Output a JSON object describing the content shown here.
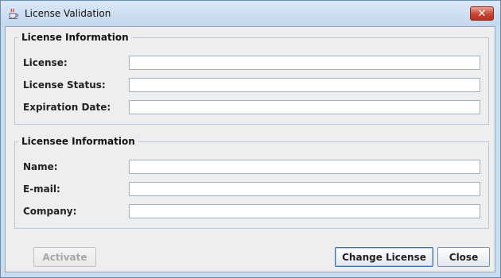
{
  "window": {
    "title": "License Validation",
    "app_icon": "java-coffee-cup-icon",
    "close_glyph": "✕"
  },
  "license_info": {
    "legend": "License Information",
    "fields": [
      {
        "label": "License:",
        "value": ""
      },
      {
        "label": "License Status:",
        "value": ""
      },
      {
        "label": "Expiration Date:",
        "value": ""
      }
    ]
  },
  "licensee_info": {
    "legend": "Licensee Information",
    "fields": [
      {
        "label": "Name:",
        "value": ""
      },
      {
        "label": "E-mail:",
        "value": ""
      },
      {
        "label": "Company:",
        "value": ""
      }
    ]
  },
  "buttons": {
    "activate": "Activate",
    "change_license": "Change License",
    "close": "Close"
  }
}
